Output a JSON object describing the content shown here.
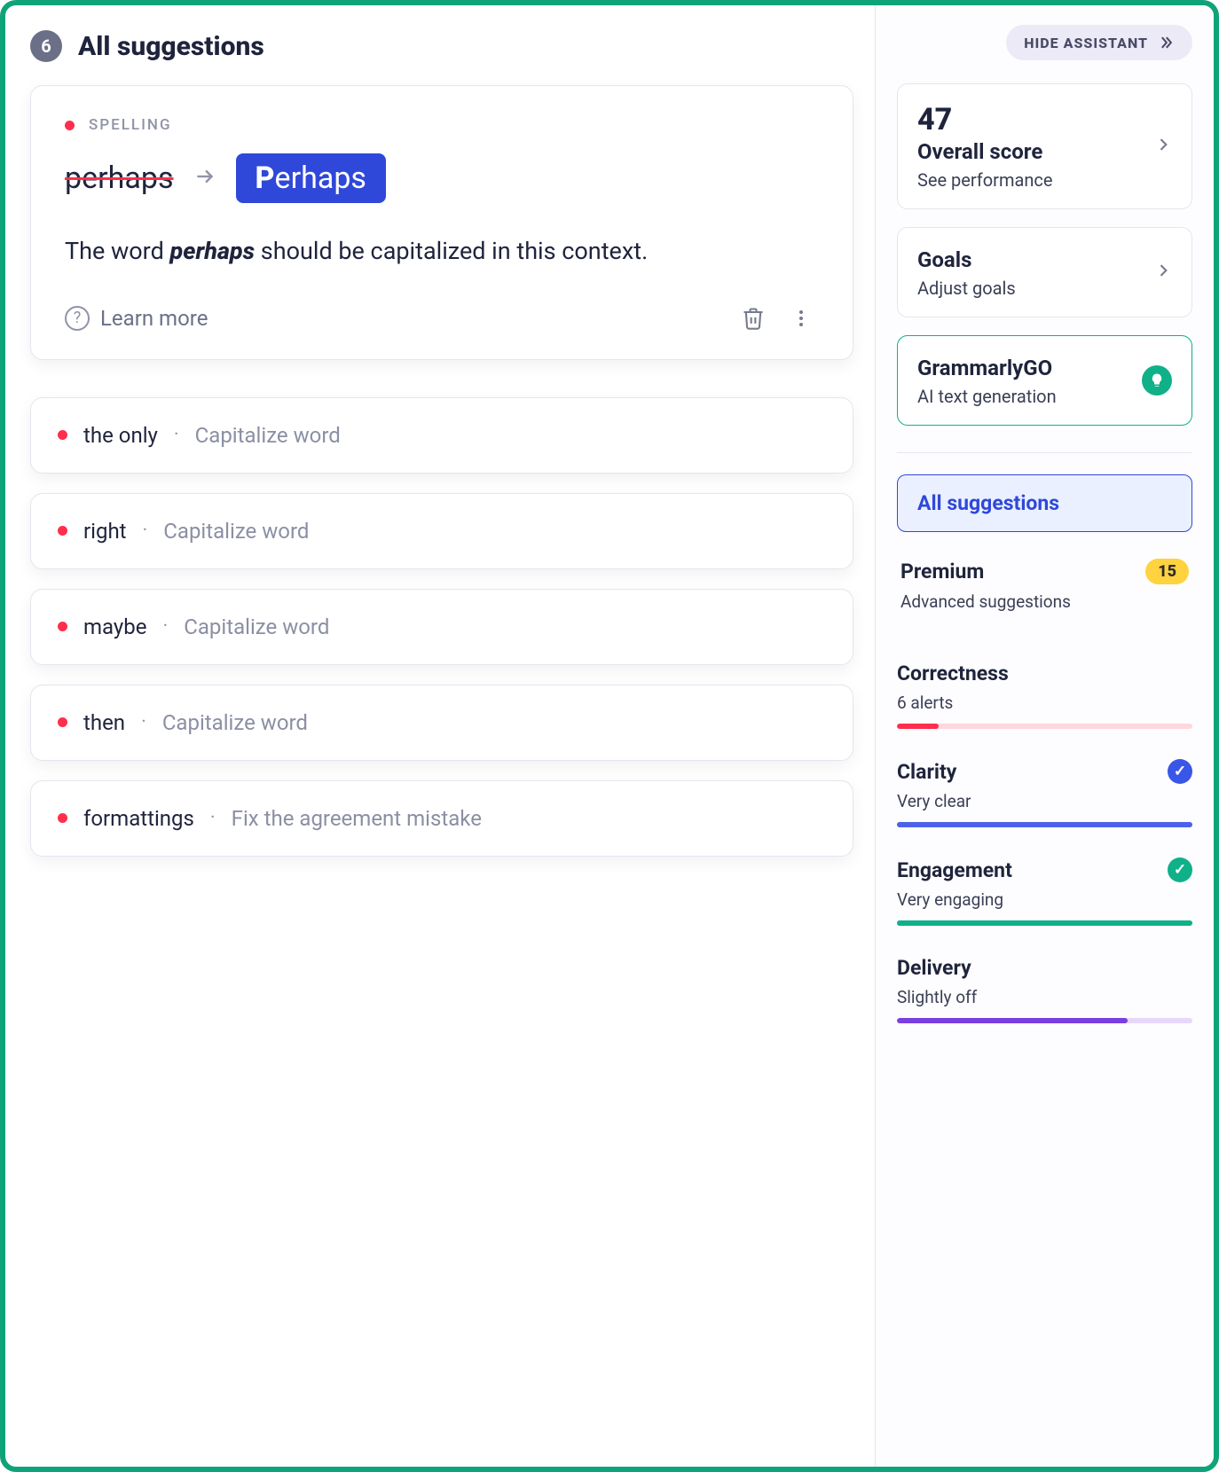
{
  "header": {
    "count": "6",
    "title": "All suggestions"
  },
  "expanded": {
    "category": "SPELLING",
    "from": "perhaps",
    "to_bold": "P",
    "to_rest": "erhaps",
    "explain_pre": "The word ",
    "explain_word": "perhaps",
    "explain_post": " should be capitalized in this context.",
    "learn_more": "Learn more"
  },
  "suggestions": [
    {
      "text": "the only",
      "hint": "Capitalize word"
    },
    {
      "text": "right",
      "hint": "Capitalize word"
    },
    {
      "text": "maybe",
      "hint": "Capitalize word"
    },
    {
      "text": "then",
      "hint": "Capitalize word"
    },
    {
      "text": "formattings",
      "hint": "Fix the agreement mistake"
    }
  ],
  "side": {
    "hide_label": "HIDE ASSISTANT",
    "score": {
      "value": "47",
      "title": "Overall score",
      "sub": "See performance"
    },
    "goals": {
      "title": "Goals",
      "sub": "Adjust goals"
    },
    "go": {
      "title": "GrammarlyGO",
      "sub": "AI text generation"
    },
    "filter_active": "All suggestions",
    "premium": {
      "title": "Premium",
      "badge": "15",
      "sub": "Advanced suggestions"
    },
    "metrics": {
      "correctness": {
        "title": "Correctness",
        "sub": "6 alerts",
        "color": "#ff2e4d",
        "track": "#ffd7de",
        "pct": 14
      },
      "clarity": {
        "title": "Clarity",
        "sub": "Very clear",
        "color": "#4e62e9",
        "track": "#4e62e9",
        "pct": 100,
        "check": "blue"
      },
      "engagement": {
        "title": "Engagement",
        "sub": "Very engaging",
        "color": "#10b089",
        "track": "#10b089",
        "pct": 100,
        "check": "green"
      },
      "delivery": {
        "title": "Delivery",
        "sub": "Slightly off",
        "color": "#7a3fe0",
        "track": "#e6d8fb",
        "pct": 78
      }
    }
  }
}
